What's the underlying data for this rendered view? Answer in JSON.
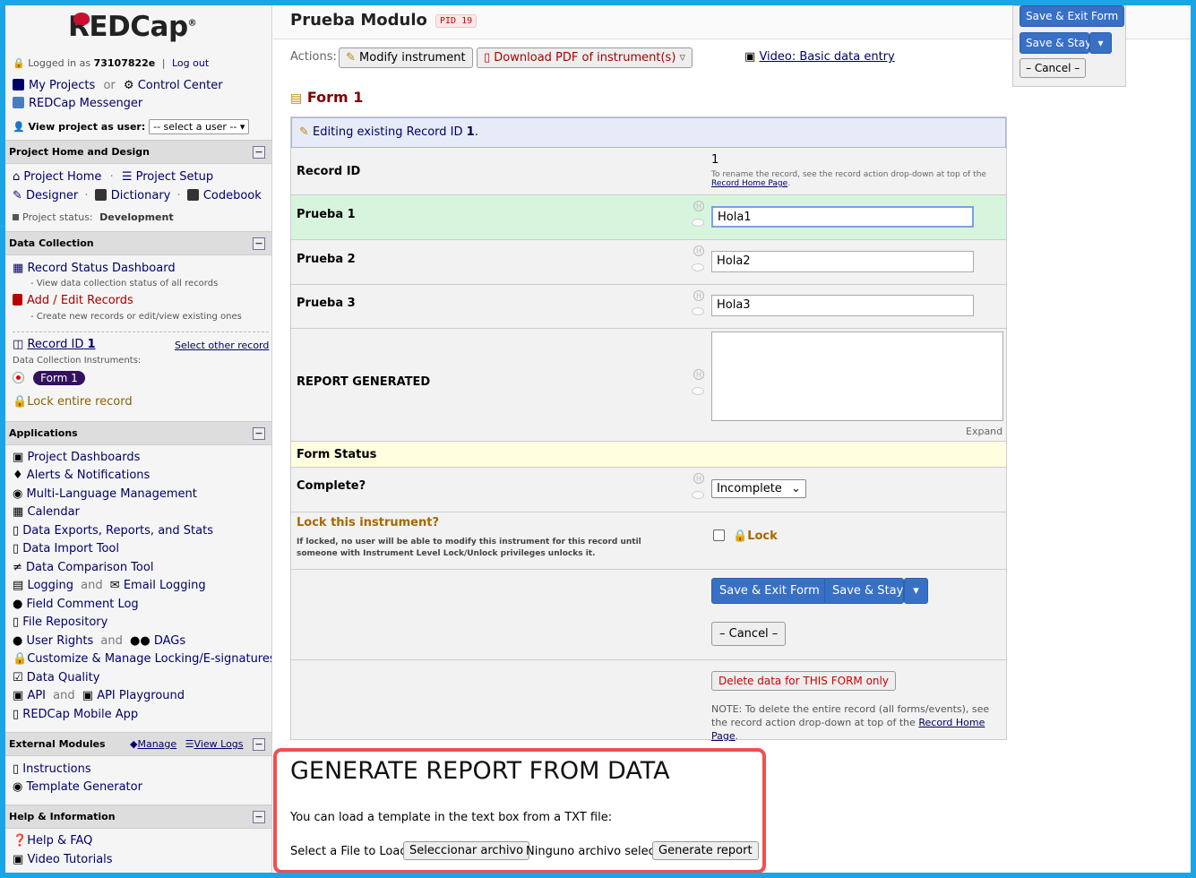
{
  "app": {
    "logo": "REDCap",
    "logo_mark": "®"
  },
  "sidebar": {
    "logged_in_prefix": "Logged in as",
    "username": "73107822e",
    "separator": "|",
    "logout": "Log out",
    "my_projects": "My Projects",
    "or": "or",
    "control_center": "Control Center",
    "messenger": "REDCap Messenger",
    "view_as_label": "View project as user:",
    "view_as_value": "-- select a user --",
    "sections": {
      "home_design": "Project Home and Design",
      "data_collection": "Data Collection",
      "applications": "Applications",
      "external_modules": "External Modules",
      "help": "Help & Information"
    },
    "project_home": "Project Home",
    "dot": "·",
    "project_setup": "Project Setup",
    "designer": "Designer",
    "dictionary": "Dictionary",
    "codebook": "Codebook",
    "status_label": "Project status:",
    "status_value": "Development",
    "record_status": "Record Status Dashboard",
    "record_status_sub": "- View data collection status of all records",
    "add_edit": "Add / Edit Records",
    "add_edit_sub": "- Create new records or edit/view existing ones",
    "record_id_label": "Record ID",
    "record_id_value": "1",
    "select_other": "Select other record",
    "instruments_label": "Data Collection Instruments:",
    "form1": "Form 1",
    "lock_record": "Lock entire record",
    "apps": [
      "Project Dashboards",
      "Alerts & Notifications",
      "Multi-Language Management",
      "Calendar",
      "Data Exports, Reports, and Stats",
      "Data Import Tool",
      "Data Comparison Tool"
    ],
    "logging": "Logging",
    "and": "and",
    "email_logging": "Email Logging",
    "field_comment": "Field Comment Log",
    "file_repo": "File Repository",
    "user_rights": "User Rights",
    "dags": "DAGs",
    "locking": "Customize & Manage Locking/E-signatures",
    "data_quality": "Data Quality",
    "api": "API",
    "api_playground": "API Playground",
    "mobile_app": "REDCap Mobile App",
    "manage": "Manage",
    "view_logs": "View Logs",
    "instructions": "Instructions",
    "template_generator": "Template Generator",
    "help_faq": "Help & FAQ",
    "video_tutorials": "Video Tutorials"
  },
  "header": {
    "title": "Prueba Modulo",
    "pid": "PID 19",
    "actions_label": "Actions:",
    "modify_instrument": "Modify instrument",
    "download_pdf": "Download PDF of instrument(s)",
    "video_link": "Video: Basic data entry"
  },
  "float": {
    "save_exit": "Save & Exit Form",
    "save_stay": "Save & Stay",
    "cancel": "– Cancel –"
  },
  "form": {
    "title": "Form 1",
    "editing_prefix": "Editing existing Record ID",
    "editing_id": "1",
    "editing_suffix": ".",
    "record_id_label": "Record ID",
    "record_id_value": "1",
    "rename_note_1": "To rename the record, see the record action drop-down at top of the",
    "rename_note_link": "Record Home Page",
    "rename_note_end": ".",
    "fields": [
      {
        "label": "Prueba 1",
        "value": "Hola1"
      },
      {
        "label": "Prueba 2",
        "value": "Hola2"
      },
      {
        "label": "Prueba 3",
        "value": "Hola3"
      }
    ],
    "report_label": "REPORT GENERATED",
    "report_value": "",
    "expand": "Expand",
    "form_status": "Form Status",
    "complete_label": "Complete?",
    "complete_value": "Incomplete",
    "lock_title": "Lock this instrument?",
    "lock_note": "If locked, no user will be able to modify this instrument for this record until someone with Instrument Level Lock/Unlock privileges unlocks it.",
    "lock_label": "Lock",
    "save_exit": "Save & Exit Form",
    "save_stay": "Save & Stay",
    "cancel": "– Cancel –",
    "delete_form": "Delete data for THIS FORM only",
    "delete_note": "NOTE: To delete the entire record (all forms/events), see the record action drop-down at top of the",
    "delete_note_link": "Record Home Page",
    "delete_note_end": "."
  },
  "report": {
    "heading": "GENERATE REPORT FROM DATA",
    "intro": "You can load a template in the text box from a TXT file:",
    "select_label": "Select a File to Load:",
    "choose_file": "Seleccionar archivo",
    "no_file": "Ninguno archivo selec.",
    "generate": "Generate report"
  },
  "colors": {
    "frame": "#1aa6e6",
    "primary_blue": "#3870c6",
    "highlight_red": "#ee5050",
    "row_green": "#d7f5dd",
    "status_yellow": "#ffffe0",
    "editing_bg": "#e7ebf7"
  },
  "icons": [
    "lock-icon",
    "projects-icon",
    "gear-icon",
    "chat-icon",
    "user-icon",
    "home-icon",
    "list-icon",
    "pencil-icon",
    "book-icon",
    "grid-icon",
    "file-icon",
    "table-icon",
    "record-dot-icon",
    "bell-icon",
    "globe-icon",
    "calendar-icon",
    "export-icon",
    "import-icon",
    "compare-icon",
    "log-icon",
    "mail-icon",
    "comment-icon",
    "folder-icon",
    "group-icon",
    "clipboard-icon",
    "monitor-icon",
    "phone-icon",
    "cube-icon",
    "film-icon",
    "question-icon",
    "pdf-icon"
  ]
}
